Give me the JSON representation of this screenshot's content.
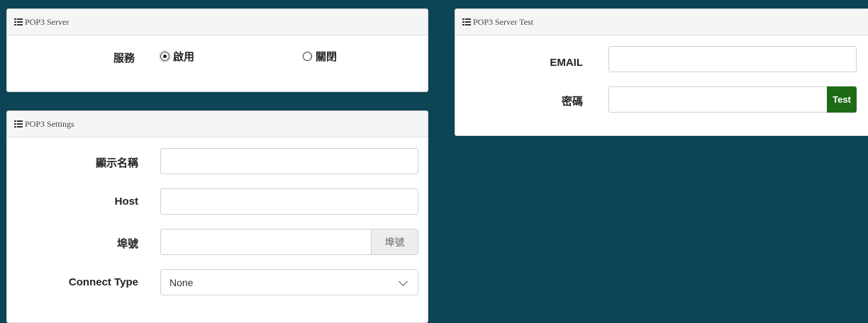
{
  "pop3_server": {
    "title": "POP3 Server",
    "service_label": "服務",
    "enable_label": "啟用",
    "disable_label": "關閉",
    "selected": "enable"
  },
  "pop3_settings": {
    "title": "POP3 Settings",
    "display_name_label": "顯示名稱",
    "display_name_value": "",
    "host_label": "Host",
    "host_value": "",
    "port_label": "埠號",
    "port_value": "",
    "port_addon": "埠號",
    "connect_type_label": "Connect Type",
    "connect_type_value": "None"
  },
  "pop3_test": {
    "title": "POP3 Server Test",
    "email_label": "EMAIL",
    "email_value": "",
    "password_label": "密碼",
    "password_value": "",
    "test_button": "Test"
  },
  "colors": {
    "background": "#0d4556",
    "test_button": "#1e6b16"
  },
  "icons": {
    "panel_header": "list-icon",
    "radio": "radio-icon",
    "select_arrow": "chevron-down-icon"
  }
}
